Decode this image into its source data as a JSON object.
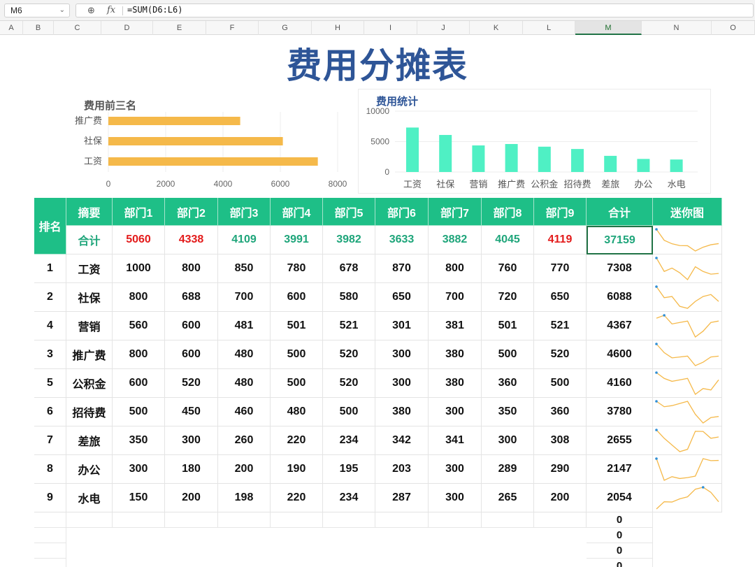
{
  "formula_bar": {
    "name_box": "M6",
    "fx_label": "fx",
    "formula": "=SUM(D6:L6)"
  },
  "columns": [
    "A",
    "B",
    "C",
    "D",
    "E",
    "F",
    "G",
    "H",
    "I",
    "J",
    "K",
    "L",
    "M",
    "N",
    "O"
  ],
  "selected_column": "M",
  "title": "费用分摊表",
  "chart_data": [
    {
      "type": "bar",
      "orientation": "horizontal",
      "title": "费用前三名",
      "categories": [
        "推广费",
        "社保",
        "工资"
      ],
      "values": [
        4600,
        6088,
        7308
      ],
      "xlim": [
        0,
        8000
      ],
      "ticks": [
        "0",
        "2000",
        "4000",
        "6000",
        "8000"
      ],
      "color": "#f5b94a",
      "grid": true
    },
    {
      "type": "bar",
      "title": "费用统计",
      "categories": [
        "工资",
        "社保",
        "营销",
        "推广费",
        "公积金",
        "招待费",
        "差旅",
        "办公",
        "水电"
      ],
      "values": [
        7308,
        6088,
        4367,
        4600,
        4160,
        3780,
        2655,
        2147,
        2054
      ],
      "ylim": [
        0,
        10000
      ],
      "ticks": [
        "0",
        "5000",
        "10000"
      ],
      "color": "#4ff0c4",
      "grid": true
    }
  ],
  "table": {
    "rank_header": "排名",
    "headers": [
      "摘要",
      "部门1",
      "部门2",
      "部门3",
      "部门4",
      "部门5",
      "部门6",
      "部门7",
      "部门8",
      "部门9",
      "合计",
      "迷你图"
    ],
    "total_row": {
      "label": "合计",
      "values": [
        "5060",
        "4338",
        "4109",
        "3991",
        "3982",
        "3633",
        "3882",
        "4045",
        "4119"
      ],
      "red": [
        true,
        true,
        false,
        false,
        false,
        false,
        false,
        false,
        true
      ],
      "sum": "37159"
    },
    "rows": [
      {
        "rank": "1",
        "name": "工资",
        "values": [
          "1000",
          "800",
          "850",
          "780",
          "678",
          "870",
          "800",
          "760",
          "770"
        ],
        "sum": "7308"
      },
      {
        "rank": "2",
        "name": "社保",
        "values": [
          "800",
          "688",
          "700",
          "600",
          "580",
          "650",
          "700",
          "720",
          "650"
        ],
        "sum": "6088"
      },
      {
        "rank": "4",
        "name": "营销",
        "values": [
          "560",
          "600",
          "481",
          "501",
          "521",
          "301",
          "381",
          "501",
          "521"
        ],
        "sum": "4367"
      },
      {
        "rank": "3",
        "name": "推广费",
        "values": [
          "800",
          "600",
          "480",
          "500",
          "520",
          "300",
          "380",
          "500",
          "520"
        ],
        "sum": "4600"
      },
      {
        "rank": "5",
        "name": "公积金",
        "values": [
          "600",
          "520",
          "480",
          "500",
          "520",
          "300",
          "380",
          "360",
          "500"
        ],
        "sum": "4160"
      },
      {
        "rank": "6",
        "name": "招待费",
        "values": [
          "500",
          "450",
          "460",
          "480",
          "500",
          "380",
          "300",
          "350",
          "360"
        ],
        "sum": "3780"
      },
      {
        "rank": "7",
        "name": "差旅",
        "values": [
          "350",
          "300",
          "260",
          "220",
          "234",
          "342",
          "341",
          "300",
          "308"
        ],
        "sum": "2655"
      },
      {
        "rank": "8",
        "name": "办公",
        "values": [
          "300",
          "180",
          "200",
          "190",
          "195",
          "203",
          "300",
          "289",
          "290"
        ],
        "sum": "2147"
      },
      {
        "rank": "9",
        "name": "水电",
        "values": [
          "150",
          "200",
          "198",
          "220",
          "234",
          "287",
          "300",
          "265",
          "200"
        ],
        "sum": "2054"
      }
    ],
    "zero_values": [
      "0",
      "0",
      "0",
      "0"
    ]
  },
  "colors": {
    "header_bg": "#1ebf87",
    "total_text": "#1ea57a",
    "highlight_red": "#e31b1b",
    "title": "#2e5597",
    "sparkline": "#f5b94a",
    "sparkline_marker": "#2f8fd6",
    "selection": "#217346"
  }
}
